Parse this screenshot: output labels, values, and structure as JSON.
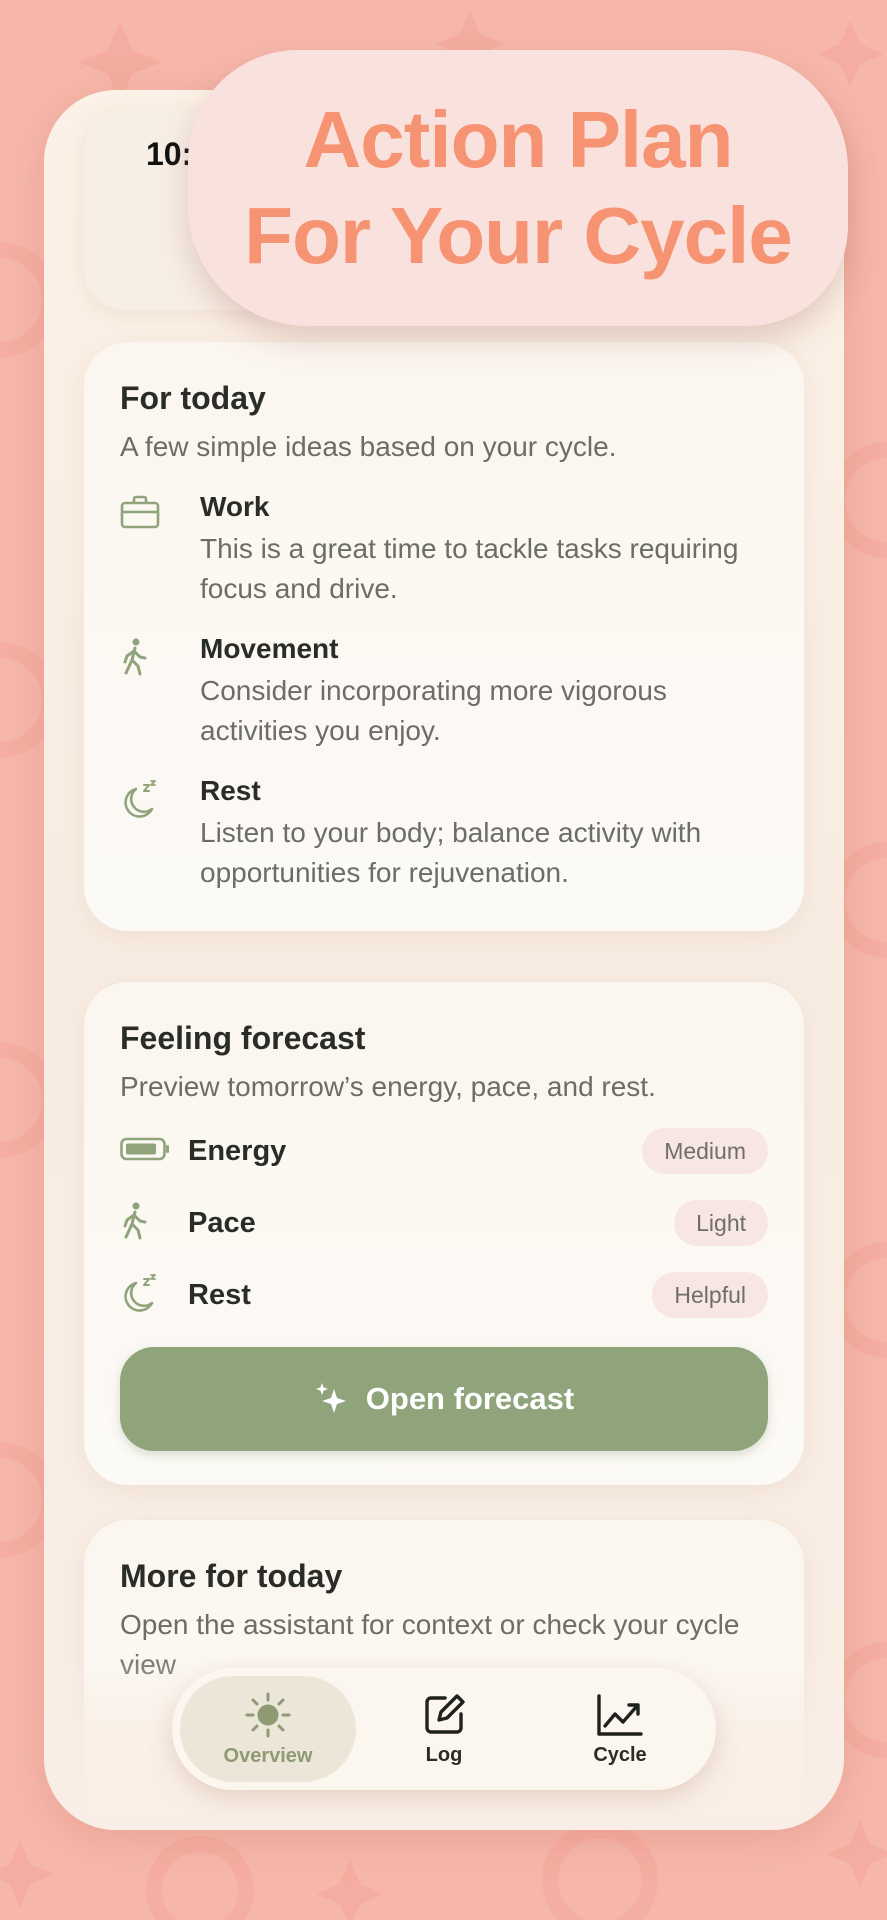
{
  "headline": {
    "line1": "Action Plan",
    "line2": "For Your Cycle"
  },
  "status": {
    "time": "10:"
  },
  "today": {
    "title": "For today",
    "subtitle": "A few simple ideas based on your cycle.",
    "items": [
      {
        "icon": "briefcase-icon",
        "title": "Work",
        "desc": "This is a great time to tackle tasks requiring focus and drive."
      },
      {
        "icon": "walking-icon",
        "title": "Movement",
        "desc": "Consider incorporating more vigorous activities you enjoy."
      },
      {
        "icon": "moon-sleep-icon",
        "title": "Rest",
        "desc": "Listen to your body; balance activity with opportunities for rejuvenation."
      }
    ]
  },
  "forecast": {
    "title": "Feeling forecast",
    "subtitle": "Preview tomorrow’s energy, pace, and rest.",
    "rows": [
      {
        "icon": "battery-icon",
        "label": "Energy",
        "value": "Medium"
      },
      {
        "icon": "walking-icon",
        "label": "Pace",
        "value": "Light"
      },
      {
        "icon": "moon-sleep-icon",
        "label": "Rest",
        "value": "Helpful"
      }
    ],
    "button_label": "Open forecast"
  },
  "more": {
    "title": "More for today",
    "subtitle": "Open the assistant for context or check your cycle view"
  },
  "tabs": [
    {
      "label": "Overview",
      "icon": "sun-icon",
      "active": true
    },
    {
      "label": "Log",
      "icon": "edit-icon",
      "active": false
    },
    {
      "label": "Cycle",
      "icon": "chart-trend-icon",
      "active": false
    }
  ],
  "colors": {
    "accent_green": "#8fa47b",
    "headline_coral": "#f69373",
    "background_pink": "#f6b7aa",
    "pill_pink": "#f8e6e2"
  }
}
